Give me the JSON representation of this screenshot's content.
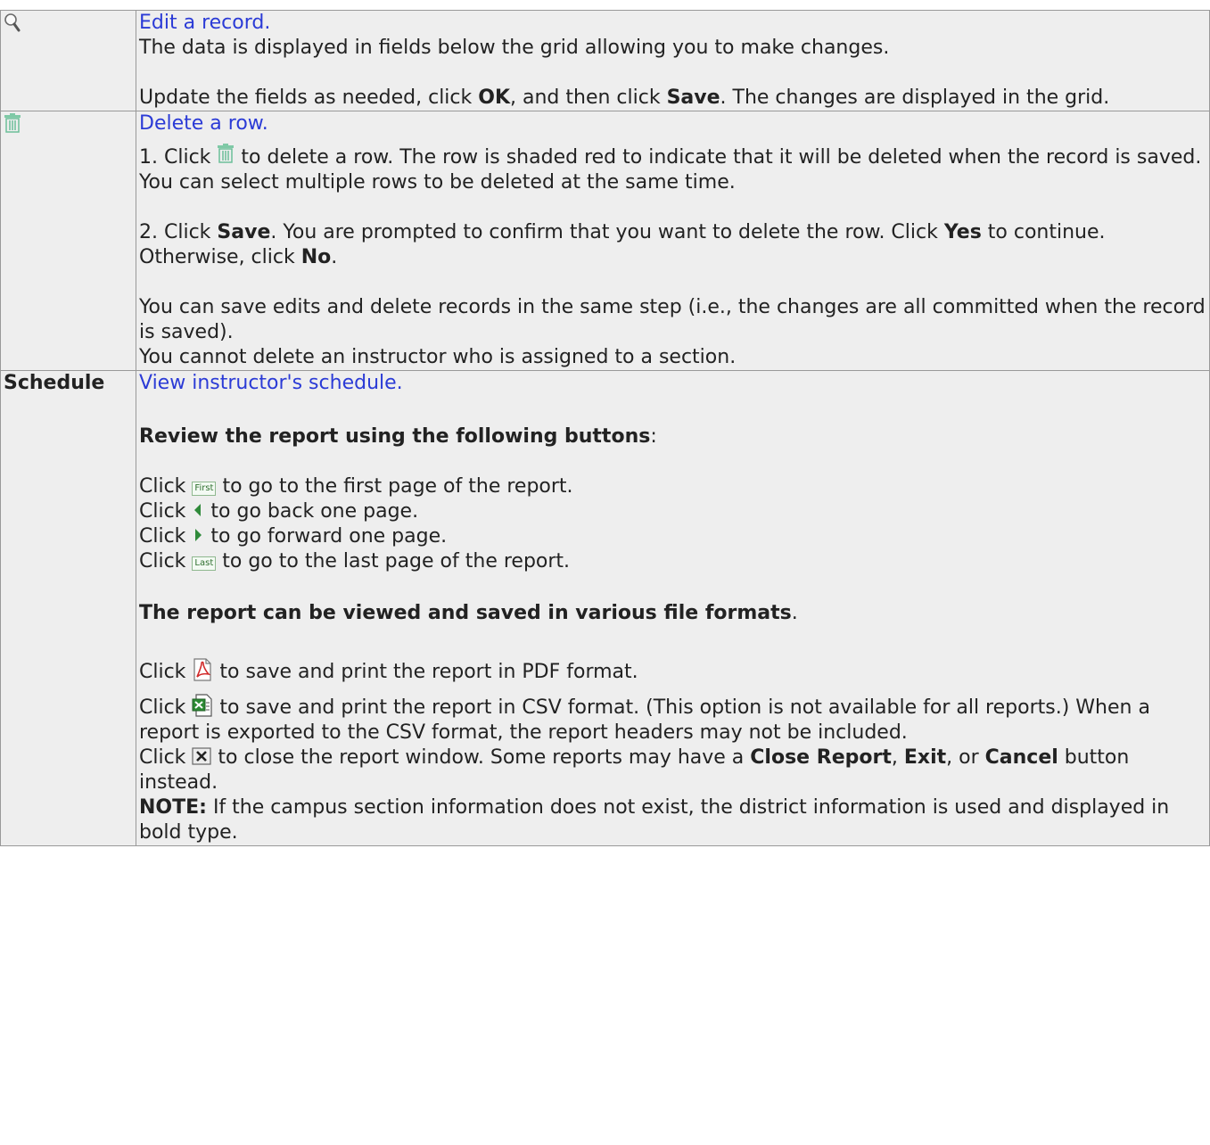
{
  "rows": [
    {
      "icon": "magnifier-icon",
      "link": "Edit a record.",
      "p1": "The data is displayed in fields below the grid allowing you to make changes.",
      "p2a": "Update the fields as needed, click ",
      "p2b": "OK",
      "p2c": ", and then click ",
      "p2d": "Save",
      "p2e": ". The changes are displayed in the grid."
    },
    {
      "icon": "trash-icon",
      "link": "Delete a row.",
      "s1a": "1. Click ",
      "s1b": " to delete a row. The row is shaded red to indicate that it will be deleted when the record is saved. You can select multiple rows to be deleted at the same time.",
      "s2a": "2. Click ",
      "s2b": "Save",
      "s2c": ". You are prompted to confirm that you want to delete the row. Click ",
      "s2d": "Yes",
      "s2e": " to continue. Otherwise, click ",
      "s2f": "No",
      "s2g": ".",
      "s3": "You can save edits and delete records in the same step (i.e., the changes are all committed when the record is saved).",
      "s4": "You cannot delete an instructor who is assigned to a section."
    },
    {
      "label": "Schedule",
      "link": "View instructor's schedule.",
      "review_head": "Review the report using the following buttons",
      "review_colon": ":",
      "click": "Click ",
      "first_btn": "First",
      "first_text": " to go to the first page of the report.",
      "back_text": " to go back one page.",
      "fwd_text": " to go forward one page.",
      "last_btn": "Last",
      "last_text": " to go to the last page of the report.",
      "formats_head": "The report can be viewed and saved in various file formats",
      "formats_dot": ".",
      "pdf_text": " to save and print the report in PDF format.",
      "csv_text": " to save and print the report in CSV format. (This option is not available for all reports.) When a report is exported to the CSV format, the report headers may not be included.",
      "close_text": " to close the report window. Some reports may have a ",
      "close_b1": "Close Report",
      "close_sep": ", ",
      "close_b2": "Exit",
      "close_or": ", or ",
      "close_b3": "Cancel",
      "close_end": " button instead.",
      "note_label": "NOTE:",
      "note_text": " If the campus section information does not exist, the district information is used and displayed in bold type."
    }
  ]
}
